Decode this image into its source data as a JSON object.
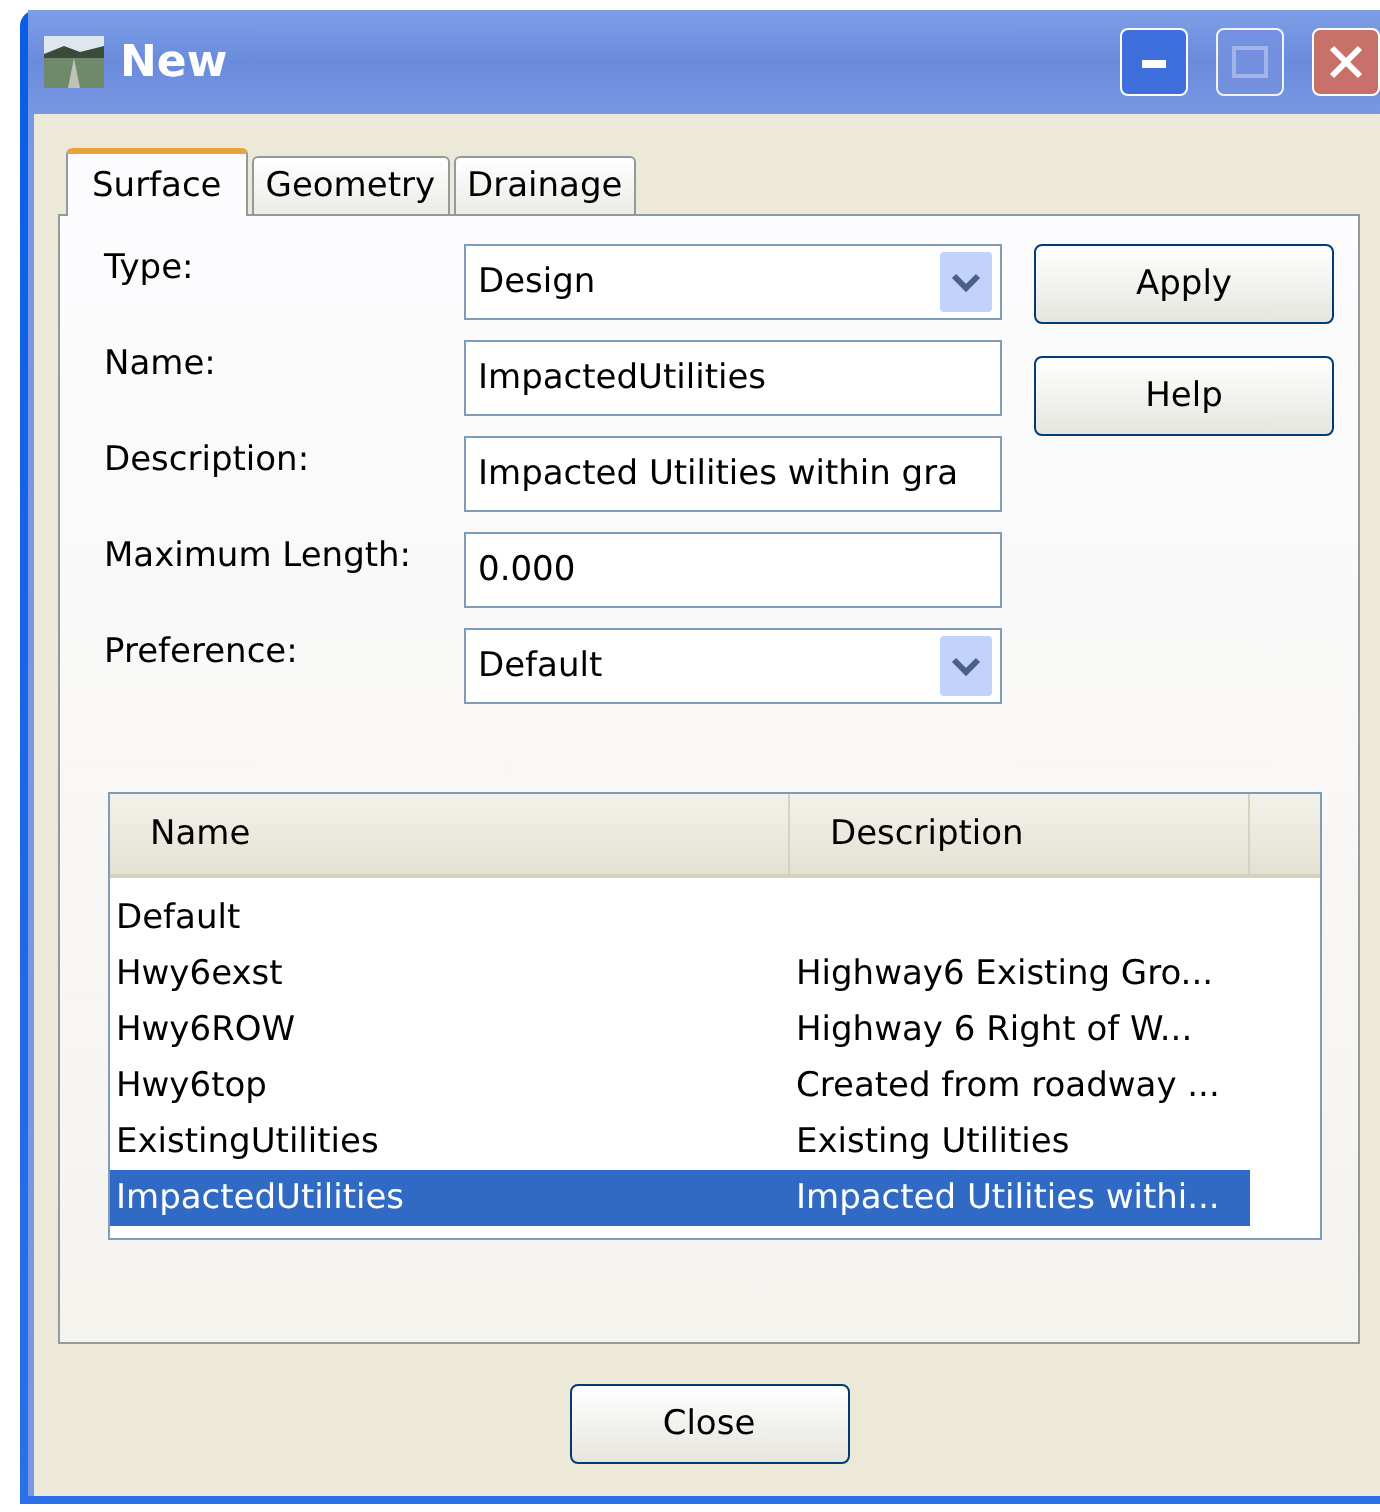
{
  "window": {
    "title": "New"
  },
  "tabs": [
    {
      "label": "Surface",
      "selected": true
    },
    {
      "label": "Geometry",
      "selected": false
    },
    {
      "label": "Drainage",
      "selected": false
    }
  ],
  "fields": [
    {
      "kind": "dropdown",
      "label": "Type:",
      "value": "Design"
    },
    {
      "kind": "text",
      "label": "Name:",
      "value": "ImpactedUtilities"
    },
    {
      "kind": "text",
      "label": "Description:",
      "value": "Impacted Utilities within gra"
    },
    {
      "kind": "text",
      "label": "Maximum Length:",
      "value": "0.000"
    },
    {
      "kind": "dropdown",
      "label": "Preference:",
      "value": "Default"
    }
  ],
  "side_buttons": [
    "Apply",
    "Help"
  ],
  "table": {
    "columns": [
      "Name",
      "Description"
    ],
    "rows": [
      {
        "name": "Default",
        "selected": false
      },
      {
        "name": "Hwy6exst",
        "description": "Highway6 Existing Gro...",
        "selected": false
      },
      {
        "name": "Hwy6ROW",
        "description": "Highway 6 Right of W...",
        "selected": false
      },
      {
        "name": "Hwy6top",
        "description": "Created from roadway ...",
        "selected": false
      },
      {
        "name": "ExistingUtilities",
        "description": "Existing Utilities",
        "selected": false
      },
      {
        "name": "ImpactedUtilities",
        "description": "Impacted Utilities withi...",
        "selected": true
      }
    ]
  },
  "footer_buttons": [
    "Close"
  ]
}
